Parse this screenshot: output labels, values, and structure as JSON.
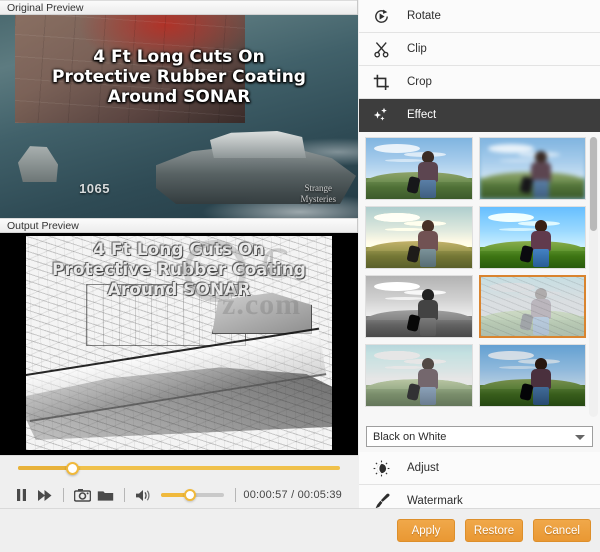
{
  "left": {
    "original_preview_label": "Original Preview",
    "output_preview_label": "Output Preview",
    "video_caption_line1": "4 Ft Long Cuts On",
    "video_caption_line2": "Protective Rubber Coating",
    "video_caption_line3": "Around SONAR",
    "corner_brand_line1": "Strange",
    "corner_brand_line2": "Mysteries",
    "ship_number": "1065",
    "watermark_text": "z.com"
  },
  "controls": {
    "progress_percent": 17,
    "volume_percent": 46,
    "current_time": "00:00:57",
    "total_time": "00:05:39",
    "time_separator": "/",
    "time_display": "00:00:57 / 00:05:39",
    "pause_icon": "pause-icon",
    "forward_icon": "fast-forward-icon",
    "snapshot_icon": "camera-icon",
    "folder_icon": "folder-icon",
    "volume_icon": "volume-icon"
  },
  "right": {
    "menu_top": [
      {
        "label": "Rotate",
        "icon": "rotate-icon",
        "active": false
      },
      {
        "label": "Clip",
        "icon": "scissors-icon",
        "active": false
      },
      {
        "label": "Crop",
        "icon": "crop-icon",
        "active": false
      },
      {
        "label": "Effect",
        "icon": "sparkle-icon",
        "active": true
      }
    ],
    "menu_bottom": [
      {
        "label": "Adjust",
        "icon": "brightness-icon",
        "active": false
      },
      {
        "label": "Watermark",
        "icon": "brush-icon",
        "active": false
      }
    ],
    "effect_select": {
      "value": "Black on White",
      "caret_icon": "chevron-down-icon"
    },
    "effects": [
      {
        "name": "Original",
        "variant": "fx-none",
        "selected": false
      },
      {
        "name": "Blur",
        "variant": "fx-blur",
        "selected": false
      },
      {
        "name": "Warm",
        "variant": "fx-warm",
        "selected": false
      },
      {
        "name": "Vivid",
        "variant": "fx-vivid",
        "selected": false
      },
      {
        "name": "Gray",
        "variant": "fx-gray",
        "selected": false
      },
      {
        "name": "Sketch",
        "variant": "fx-sketch",
        "selected": true
      },
      {
        "name": "Pale",
        "variant": "fx-pale",
        "selected": false
      },
      {
        "name": "Dark",
        "variant": "fx-dark",
        "selected": false
      }
    ]
  },
  "footer": {
    "apply_label": "Apply",
    "restore_label": "Restore",
    "cancel_label": "Cancel"
  },
  "colors": {
    "accent_orange": "#e99833",
    "slider_yellow": "#f0c14b",
    "active_row_bg": "#3d3d3d",
    "panel_bg": "#efefef",
    "selected_thumb_border": "#d9842f"
  }
}
